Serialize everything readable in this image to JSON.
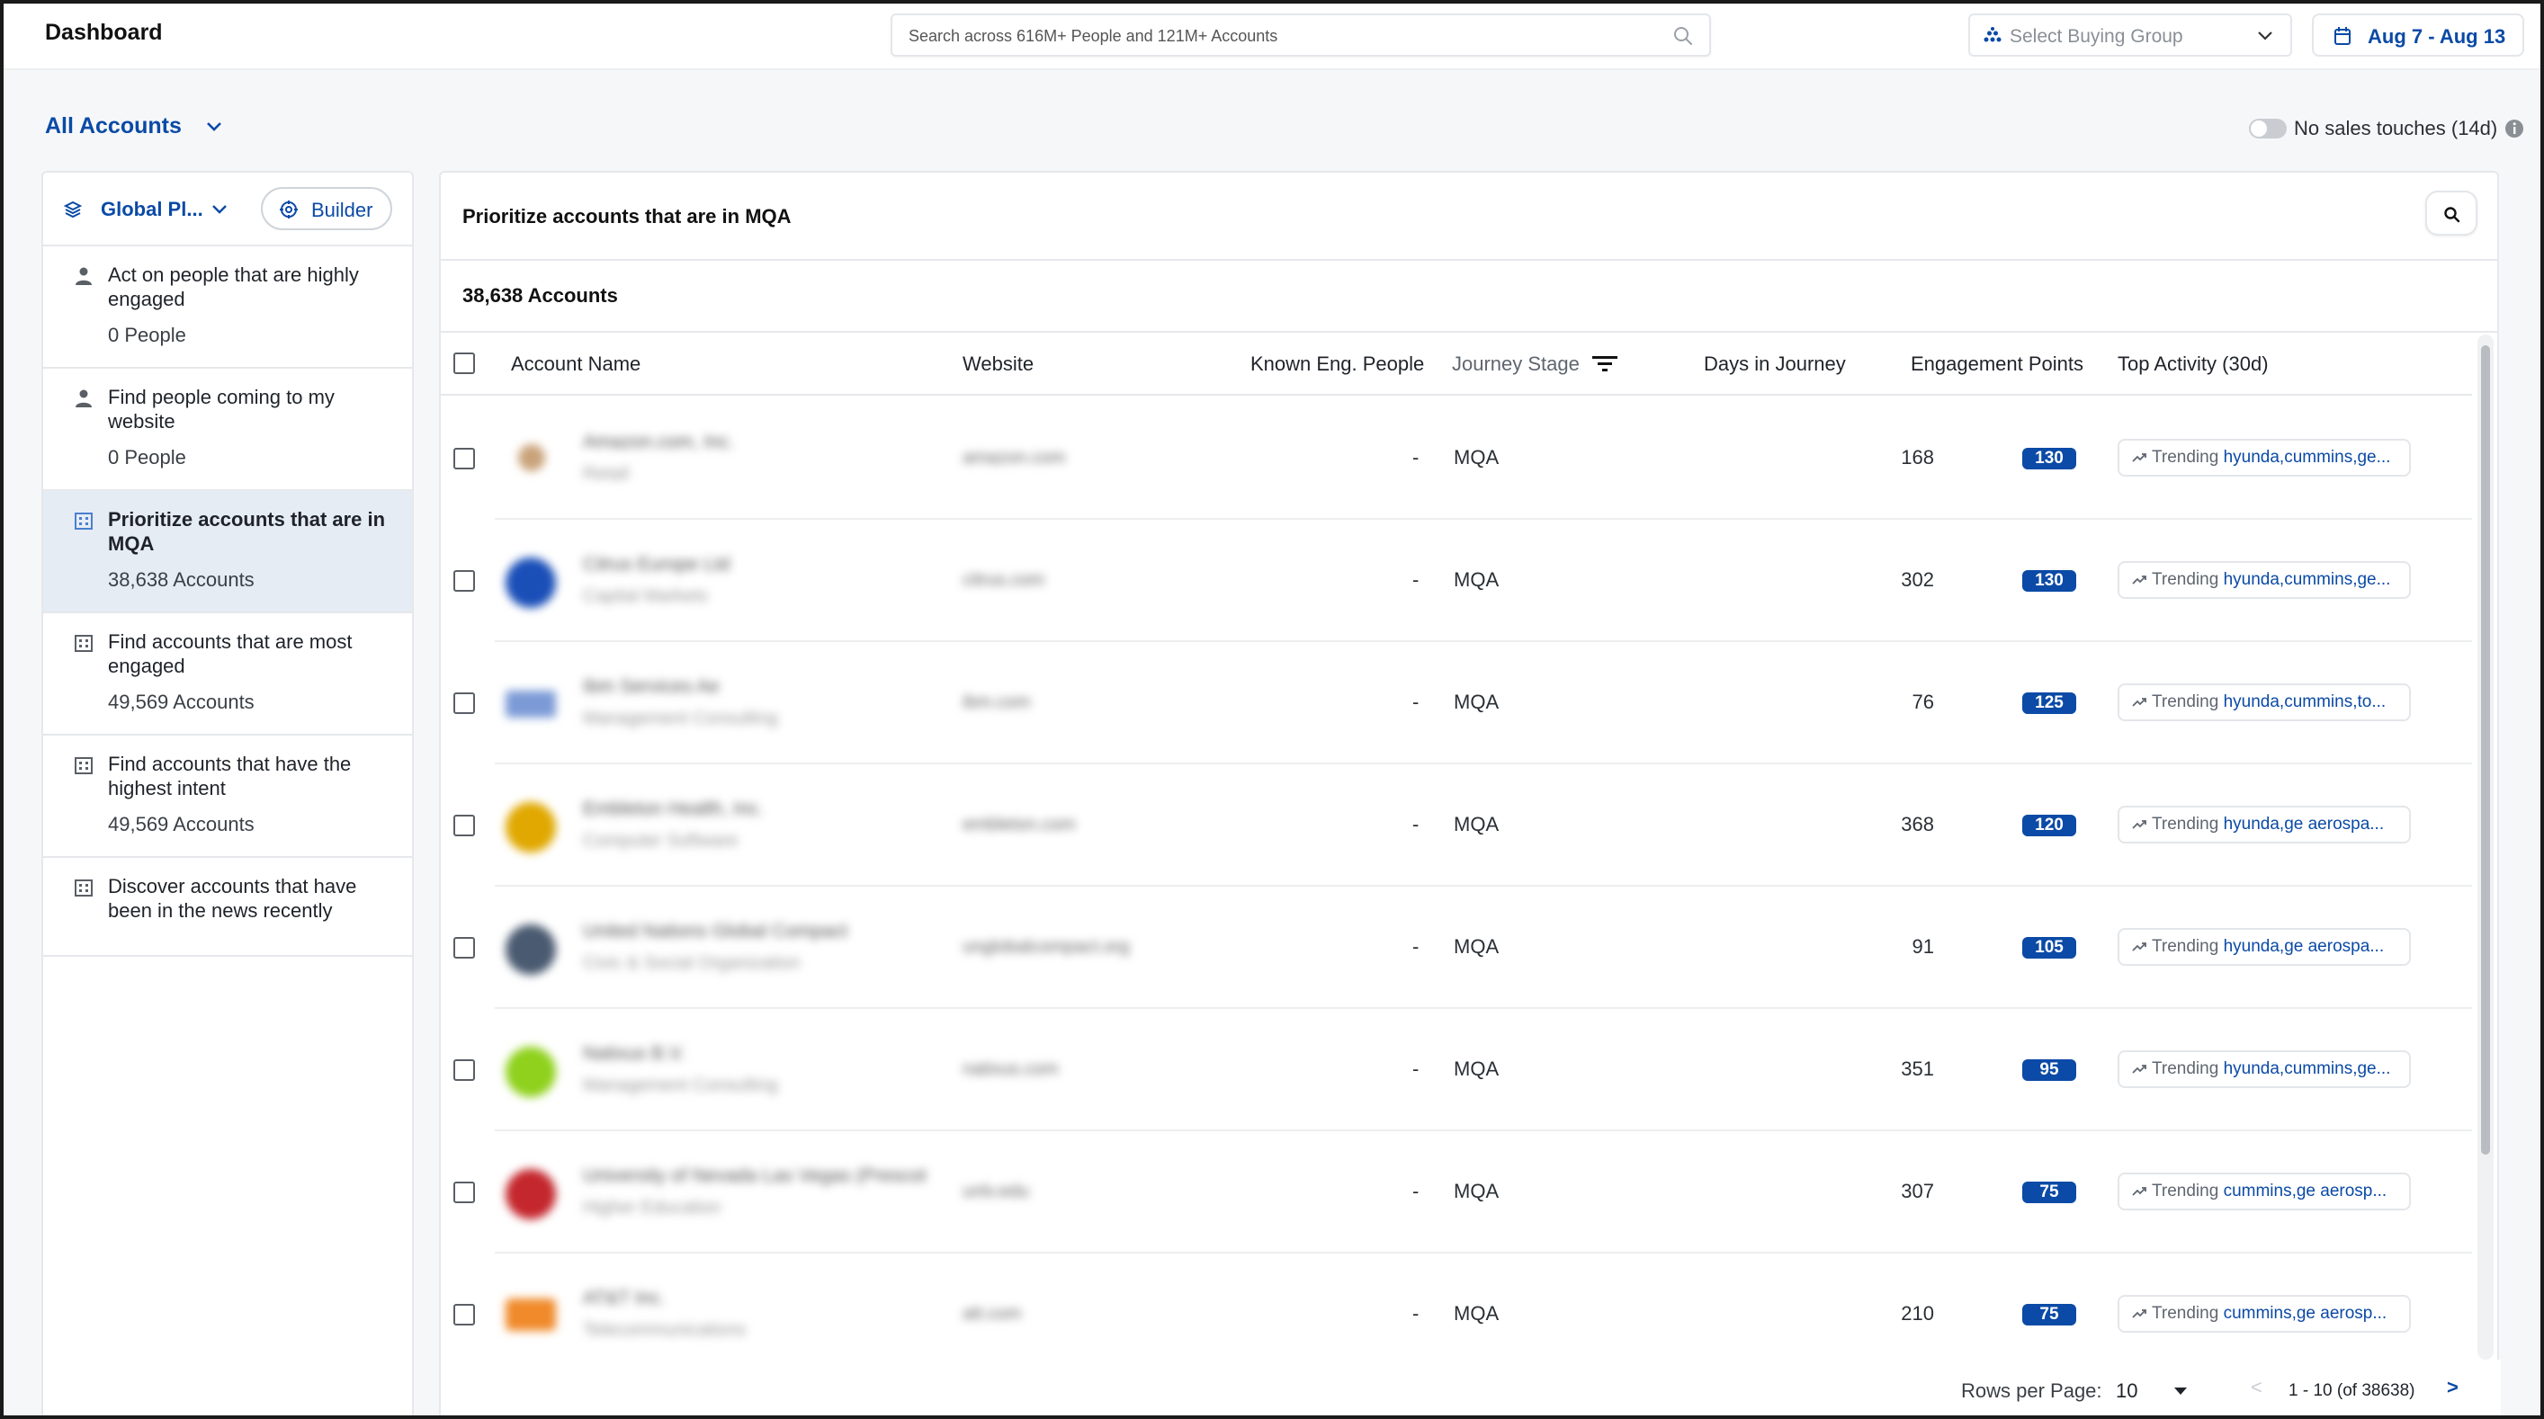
{
  "header": {
    "title": "Dashboard",
    "search_placeholder": "Search across 616M+ People and 121M+ Accounts",
    "buying_group_label": "Select Buying Group",
    "date_range": "Aug 7 - Aug 13"
  },
  "subheader": {
    "view_label": "All Accounts",
    "toggle_label": "No sales touches (14d)",
    "toggle_on": false
  },
  "sidebar": {
    "playbook_label": "Global Pl...",
    "builder_label": "Builder",
    "items": [
      {
        "title": "Act on people that are highly engaged",
        "count": "0 People",
        "icon": "person-icon",
        "active": false
      },
      {
        "title": "Find people coming to my website",
        "count": "0 People",
        "icon": "person-icon",
        "active": false
      },
      {
        "title": "Prioritize accounts that are in MQA",
        "count": "38,638 Accounts",
        "icon": "building-icon",
        "active": true
      },
      {
        "title": "Find accounts that are most engaged",
        "count": "49,569 Accounts",
        "icon": "building-icon",
        "active": false
      },
      {
        "title": "Find accounts that have the highest intent",
        "count": "49,569 Accounts",
        "icon": "building-icon",
        "active": false
      },
      {
        "title": "Discover accounts that have been in the news recently",
        "count": "",
        "icon": "building-icon",
        "active": false
      }
    ]
  },
  "main": {
    "title": "Prioritize accounts that are in MQA",
    "count_label": "38,638 Accounts",
    "columns": [
      "Account Name",
      "Website",
      "Known Eng. People",
      "Journey Stage",
      "Days in Journey",
      "Engagement Points",
      "Top Activity (30d)"
    ],
    "rows": [
      {
        "name": "Amazon.com, Inc.",
        "industry": "Retail",
        "website": "amazon.com",
        "known": "-",
        "stage": "MQA",
        "days": "168",
        "points": "130",
        "trend_label": "Trending",
        "trend_terms": "hyunda,cummins,ge...",
        "avatar_color": "#c9a27a"
      },
      {
        "name": "Citrus Europe Ltd",
        "industry": "Capital Markets",
        "website": "citrus.com",
        "known": "-",
        "stage": "MQA",
        "days": "302",
        "points": "130",
        "trend_label": "Trending",
        "trend_terms": "hyunda,cummins,ge...",
        "avatar_color": "#1a4fb8"
      },
      {
        "name": "Ibm Services Ae",
        "industry": "Management Consulting",
        "website": "ibm.com",
        "known": "-",
        "stage": "MQA",
        "days": "76",
        "points": "125",
        "trend_label": "Trending",
        "trend_terms": "hyunda,cummins,to...",
        "avatar_color": "#7b9ad6"
      },
      {
        "name": "Embleton Health, Inc.",
        "industry": "Computer Software",
        "website": "embleton.com",
        "known": "-",
        "stage": "MQA",
        "days": "368",
        "points": "120",
        "trend_label": "Trending",
        "trend_terms": "hyunda,ge aerospa...",
        "avatar_color": "#e0a800"
      },
      {
        "name": "United Nations Global Compact",
        "industry": "Civic & Social Organization",
        "website": "unglobalcompact.org",
        "known": "-",
        "stage": "MQA",
        "days": "91",
        "points": "105",
        "trend_label": "Trending",
        "trend_terms": "hyunda,ge aerospa...",
        "avatar_color": "#4a5a70"
      },
      {
        "name": "Natixus B.V.",
        "industry": "Management Consulting",
        "website": "natixus.com",
        "known": "-",
        "stage": "MQA",
        "days": "351",
        "points": "95",
        "trend_label": "Trending",
        "trend_terms": "hyunda,cummins,ge...",
        "avatar_color": "#8fd11c"
      },
      {
        "name": "University of Nevada Las Vegas (Prescot",
        "industry": "Higher Education",
        "website": "unlv.edu",
        "known": "-",
        "stage": "MQA",
        "days": "307",
        "points": "75",
        "trend_label": "Trending",
        "trend_terms": "cummins,ge aerosp...",
        "avatar_color": "#c4272d"
      },
      {
        "name": "AT&T Inc.",
        "industry": "Telecommunications",
        "website": "att.com",
        "known": "-",
        "stage": "MQA",
        "days": "210",
        "points": "75",
        "trend_label": "Trending",
        "trend_terms": "cummins,ge aerosp...",
        "avatar_color": "#f08a2a"
      }
    ]
  },
  "footer": {
    "rows_per_page_label": "Rows per Page:",
    "rows_per_page_value": "10",
    "prev": "<",
    "range": "1 - 10 (of 38638)",
    "next": ">"
  },
  "colors": {
    "accent": "#0b4aa6",
    "active_item_bg": "#e6ecf4"
  }
}
